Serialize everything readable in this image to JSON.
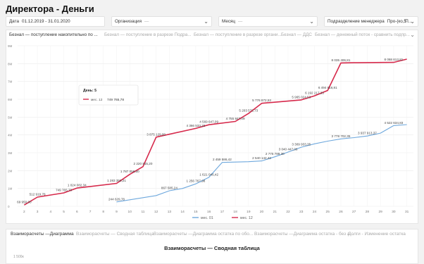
{
  "page": {
    "title": "Директора - Деньги"
  },
  "filters": {
    "date": {
      "label": "Дата",
      "value": "01.12.2019 - 31.01.2020"
    },
    "org": {
      "label": "Организация",
      "placeholder": "—"
    },
    "month": {
      "label": "Месяц",
      "placeholder": "—"
    },
    "dept": {
      "label": "Подразделение менеджера",
      "value": "Про-(ко, П...",
      "count": "5"
    }
  },
  "tabs": [
    {
      "label": "Безнал — поступление накопительно по ...",
      "active": true
    },
    {
      "label": "Безнал — поступление в разрезе Подра...",
      "active": false
    },
    {
      "label": "Безнал — поступление в разрезе органи...",
      "active": false
    },
    {
      "label": "Безнал — ДДС",
      "active": false
    },
    {
      "label": "Безнал — денежный поток - сравнить подпр...",
      "active": false
    }
  ],
  "tooltip": {
    "title": "День: 5",
    "series": "мес. 12",
    "value": "749 765,78"
  },
  "chart_data": {
    "type": "line",
    "x": [
      2,
      3,
      4,
      5,
      6,
      7,
      8,
      9,
      10,
      11,
      12,
      13,
      14,
      15,
      16,
      17,
      18,
      19,
      20,
      21,
      22,
      23,
      24,
      25,
      26,
      27,
      28,
      29,
      30,
      31
    ],
    "ylim": [
      0,
      9000000
    ],
    "y_ticks": [
      "0",
      "1M",
      "2M",
      "3M",
      "4M",
      "5M",
      "6M",
      "7M",
      "8M",
      "9M"
    ],
    "y_tick_values": [
      0,
      1000000,
      2000000,
      3000000,
      4000000,
      5000000,
      6000000,
      7000000,
      8000000,
      9000000
    ],
    "grid": true,
    "legend_position": "bottom",
    "series": [
      {
        "name": "мес. 01",
        "color": "#6ea8dd",
        "values": [
          null,
          null,
          null,
          null,
          null,
          null,
          null,
          null,
          244629.78,
          null,
          null,
          867585.24,
          null,
          1256767.98,
          1621046.42,
          2459586.42,
          null,
          null,
          2540142.42,
          2775789.3,
          3040447.06,
          3309933.35,
          null,
          3778702.35,
          3937913.37,
          null,
          4522634.83,
          null,
          null,
          null
        ],
        "points": [
          [
            9,
            244629.78
          ],
          [
            12,
            600000
          ],
          [
            13,
            867585.24
          ],
          [
            14,
            1000000
          ],
          [
            15,
            1256767.98
          ],
          [
            16,
            1621046.42
          ],
          [
            17,
            2459586.42
          ],
          [
            18,
            2480000
          ],
          [
            19,
            2500000
          ],
          [
            20,
            2540142.42
          ],
          [
            21,
            2775789.3
          ],
          [
            22,
            3040447.06
          ],
          [
            23,
            3309933.35
          ],
          [
            24,
            3500000
          ],
          [
            25,
            3650000
          ],
          [
            26,
            3778702.35
          ],
          [
            27,
            3850000
          ],
          [
            28,
            3937913.37
          ],
          [
            29,
            4100000
          ],
          [
            30,
            4522634.83
          ],
          [
            31,
            4580000
          ]
        ],
        "labels": [
          {
            "x": 9,
            "y": 244629.78,
            "text": "244 629,78"
          },
          {
            "x": 13,
            "y": 867585.24,
            "text": "867 585,24"
          },
          {
            "x": 15,
            "y": 1256767.98,
            "text": "1 256 767,98"
          },
          {
            "x": 16,
            "y": 1621046.42,
            "text": "1 621 046,42"
          },
          {
            "x": 17,
            "y": 2459586.42,
            "text": "2 459 586,42"
          },
          {
            "x": 20,
            "y": 2540142.42,
            "text": "2 540 142,42"
          },
          {
            "x": 21,
            "y": 2775789.3,
            "text": "2 775 789,30"
          },
          {
            "x": 22,
            "y": 3040447.06,
            "text": "3 040 447,06"
          },
          {
            "x": 23,
            "y": 3309933.35,
            "text": "3 309 933,35"
          },
          {
            "x": 26,
            "y": 3778702.35,
            "text": "3 778 702,35"
          },
          {
            "x": 28,
            "y": 3937913.37,
            "text": "3 937 913,37"
          },
          {
            "x": 30,
            "y": 4522634.83,
            "text": "4 522 634,83"
          }
        ]
      },
      {
        "name": "мес. 12",
        "color": "#d6294b",
        "points": [
          [
            2,
            69950
          ],
          [
            3,
            512919.78
          ],
          [
            5,
            749765.78
          ],
          [
            6,
            1024082.34
          ],
          [
            9,
            1283358.21
          ],
          [
            10,
            1787056.5
          ],
          [
            11,
            2220815.2
          ],
          [
            12,
            3875129.8
          ],
          [
            15,
            4366533.33
          ],
          [
            16,
            4569647.09
          ],
          [
            18,
            4755847.09
          ],
          [
            19,
            5203572.73
          ],
          [
            20,
            5776872.53
          ],
          [
            23,
            5965024.53
          ],
          [
            24,
            6192217.33
          ],
          [
            25,
            6494616.81
          ],
          [
            26,
            8035406.81
          ],
          [
            27,
            8050000
          ],
          [
            30,
            8068613.81
          ],
          [
            31,
            8250000
          ]
        ],
        "labels": [
          {
            "x": 2,
            "y": 69950,
            "text": "69 950,00"
          },
          {
            "x": 3,
            "y": 512919.78,
            "text": "512 919,78"
          },
          {
            "x": 5,
            "y": 749765.78,
            "text": "749 765,78"
          },
          {
            "x": 6,
            "y": 1024082.34,
            "text": "1 024 082,34"
          },
          {
            "x": 9,
            "y": 1283358.21,
            "text": "1 283 358,21"
          },
          {
            "x": 10,
            "y": 1787056.5,
            "text": "1 787 056,50"
          },
          {
            "x": 11,
            "y": 2220815.2,
            "text": "2 220 815,20"
          },
          {
            "x": 12,
            "y": 3875129.8,
            "text": "3 875 129,80"
          },
          {
            "x": 15,
            "y": 4366533.33,
            "text": "4 366 533,33"
          },
          {
            "x": 16,
            "y": 4569647.09,
            "text": "4 569 647,09"
          },
          {
            "x": 18,
            "y": 4755847.09,
            "text": "4 755 847,09"
          },
          {
            "x": 19,
            "y": 5203572.73,
            "text": "5 203 572,73"
          },
          {
            "x": 20,
            "y": 5776872.53,
            "text": "5 776 872,53"
          },
          {
            "x": 23,
            "y": 5965024.53,
            "text": "5 965 024,53"
          },
          {
            "x": 24,
            "y": 6192217.33,
            "text": "6 192 217,33"
          },
          {
            "x": 25,
            "y": 6494616.81,
            "text": "6 494 616,81"
          },
          {
            "x": 26,
            "y": 8035406.81,
            "text": "8 035 406,81"
          },
          {
            "x": 30,
            "y": 8068613.81,
            "text": "8 068 613,81"
          }
        ]
      }
    ]
  },
  "bottom": {
    "tabs": [
      {
        "label": "Взаиморасчеты —Диаграмма",
        "active": true
      },
      {
        "label": "Взаиморасчеты — Сводная таблица",
        "active": false
      },
      {
        "label": "Взаиморасчеты —Диаграмма остатка по обо...",
        "active": false
      },
      {
        "label": "Взаиморасчеты —Диаграмма остатка - без а...",
        "active": false
      },
      {
        "label": "Долги - Изменение остатка",
        "active": false
      }
    ],
    "title": "Взаиморасчеты — Сводная таблица",
    "axis_label": "1 500к"
  }
}
